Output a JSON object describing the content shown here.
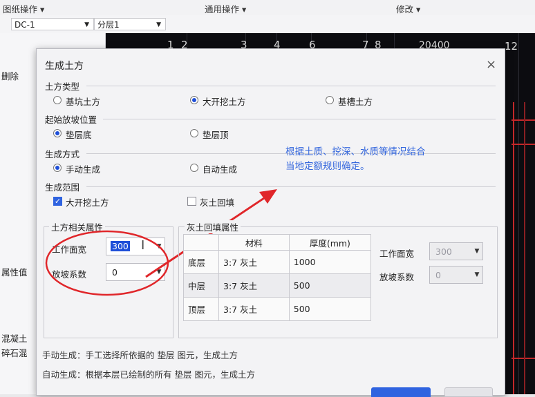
{
  "app": {
    "menus": [
      "图纸操作 ▾",
      "通用操作 ▾",
      "修改 ▾"
    ],
    "combo_drawing": "DC-1",
    "combo_layer": "分层1",
    "axis_labels": [
      "1",
      "2",
      "3",
      "4",
      "6",
      "7",
      "8",
      "12"
    ],
    "axis_dimension": "20400",
    "left_panel": {
      "delete_label": "删除",
      "prop_value_label": "属性值",
      "concrete_label": "混凝土",
      "gravel_label": "碎石混"
    }
  },
  "dialog": {
    "title": "生成土方",
    "close_glyph": "×",
    "earth_type": {
      "heading": "土方类型",
      "options": [
        "基坑土方",
        "大开挖土方",
        "基槽土方"
      ],
      "selected": 1
    },
    "slope_start": {
      "heading": "起始放坡位置",
      "options": [
        "垫层底",
        "垫层顶"
      ],
      "selected": 0
    },
    "gen_mode": {
      "heading": "生成方式",
      "options": [
        "手动生成",
        "自动生成"
      ],
      "selected": 0
    },
    "gen_range": {
      "heading": "生成范围",
      "options": [
        "大开挖土方",
        "灰土回填"
      ],
      "checked": [
        true,
        false
      ]
    },
    "earth_props": {
      "heading": "土方相关属性",
      "work_width_label": "工作面宽",
      "work_width_value": "300",
      "slope_coef_label": "放坡系数",
      "slope_coef_value": "0"
    },
    "backfill": {
      "heading": "灰土回填属性",
      "columns": [
        "",
        "材料",
        "厚度(mm)"
      ],
      "rows": [
        {
          "layer": "底层",
          "material": "3:7 灰土",
          "thickness": "1000"
        },
        {
          "layer": "中层",
          "material": "3:7 灰土",
          "thickness": "500"
        },
        {
          "layer": "顶层",
          "material": "3:7 灰土",
          "thickness": "500"
        }
      ],
      "work_width_label": "工作面宽",
      "work_width_value": "300",
      "slope_coef_label": "放坡系数",
      "slope_coef_value": "0"
    },
    "notes": [
      "手动生成：手工选择所依据的 垫层 图元，生成土方",
      "自动生成：根据本层已绘制的所有 垫层 图元，生成土方"
    ]
  },
  "annotation": {
    "line1": "根据土质、挖深、水质等情况结合",
    "line2": "当地定额规则确定。",
    "color": "#3366dd"
  },
  "colors": {
    "accent": "#2f63e0",
    "highlight_red": "#e0262a"
  }
}
